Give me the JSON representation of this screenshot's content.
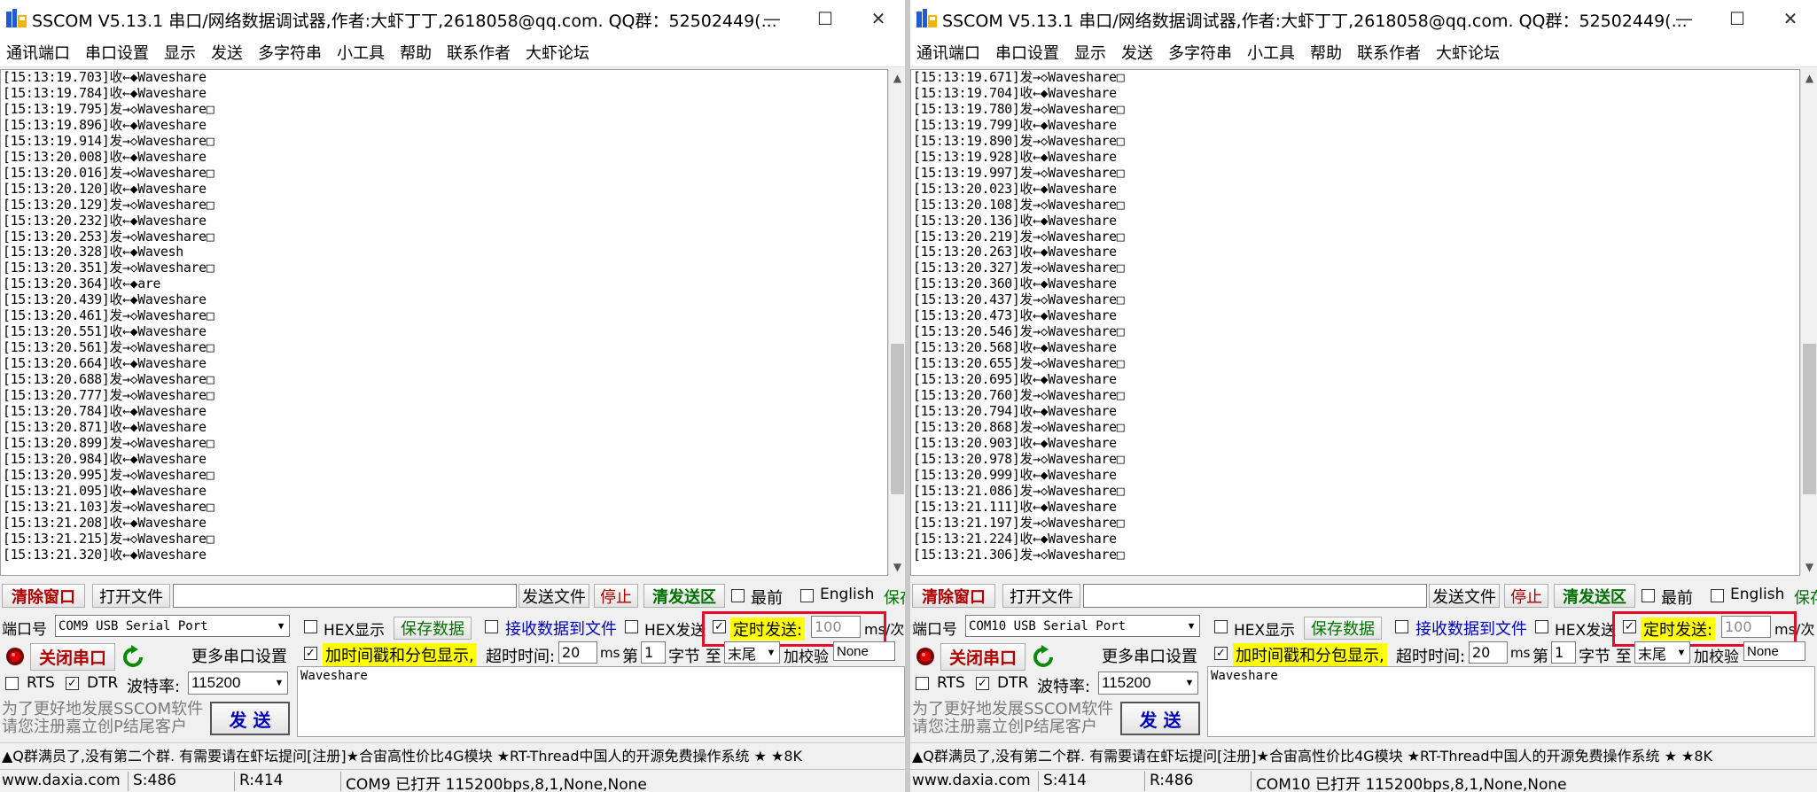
{
  "windows": [
    {
      "title": "SSCOM V5.13.1 串口/网络数据调试器,作者:大虾丁丁,2618058@qq.com. QQ群：52502449(...",
      "menu": [
        "通讯端口",
        "串口设置",
        "显示",
        "发送",
        "多字符串",
        "小工具",
        "帮助",
        "联系作者",
        "大虾论坛"
      ],
      "log": [
        "[15:13:19.703]收←◆Waveshare",
        "[15:13:19.784]收←◆Waveshare",
        "[15:13:19.795]发→◇Waveshare□",
        "[15:13:19.896]收←◆Waveshare",
        "[15:13:19.914]发→◇Waveshare□",
        "[15:13:20.008]收←◆Waveshare",
        "[15:13:20.016]发→◇Waveshare□",
        "[15:13:20.120]收←◆Waveshare",
        "[15:13:20.129]发→◇Waveshare□",
        "[15:13:20.232]收←◆Waveshare",
        "[15:13:20.253]发→◇Waveshare□",
        "[15:13:20.328]收←◆Wavesh",
        "[15:13:20.351]发→◇Waveshare□",
        "[15:13:20.364]收←◆are",
        "[15:13:20.439]收←◆Waveshare",
        "[15:13:20.461]发→◇Waveshare□",
        "[15:13:20.551]收←◆Waveshare",
        "[15:13:20.561]发→◇Waveshare□",
        "[15:13:20.664]收←◆Waveshare",
        "[15:13:20.688]发→◇Waveshare□",
        "[15:13:20.777]发→◇Waveshare□",
        "[15:13:20.784]收←◆Waveshare",
        "[15:13:20.871]收←◆Waveshare",
        "[15:13:20.899]发→◇Waveshare□",
        "[15:13:20.984]收←◆Waveshare",
        "[15:13:20.995]发→◇Waveshare□",
        "[15:13:21.095]收←◆Waveshare",
        "[15:13:21.103]发→◇Waveshare□",
        "[15:13:21.208]收←◆Waveshare",
        "[15:13:21.215]发→◇Waveshare□",
        "[15:13:21.320]收←◆Waveshare"
      ],
      "scroll_position": 0.8,
      "clear_btn": "清除窗口",
      "open_file_btn": "打开文件",
      "send_file_btn": "发送文件",
      "stop_btn": "停止",
      "clear_send_btn": "清发送区",
      "front_label": "最前",
      "english_label": "English",
      "save_param_label": "保存参数",
      "port_label": "端口号",
      "port_value": "COM9 USB Serial Port",
      "hex_display": "HEX显示",
      "save_data_btn": "保存数据",
      "recv_to_file": "接收数据到文件",
      "hex_send": "HEX发送",
      "timed_send": "定时发送:",
      "timed_send_value": "100",
      "timed_unit": "ms/次",
      "close_port_btn": "关闭串口",
      "more_settings_btn": "更多串口设置",
      "timestamp_label": "加时间戳和分包显示,",
      "timeout_label": "超时时间:",
      "timeout_value": "20",
      "ms_label": "ms",
      "byte_prefix": "第",
      "byte_value": "1",
      "byte_mid": "字节 至",
      "byte_end": "末尾",
      "checksum_label": "加校验",
      "checksum_value": "None",
      "rts_label": "RTS",
      "dtr_label": "DTR",
      "baud_label": "波特率:",
      "baud_value": "115200",
      "send_text": "Waveshare",
      "promo_line1": "为了更好地发展SSCOM软件",
      "promo_line2": "请您注册嘉立创P结尾客户",
      "send_btn": "发 送",
      "ticker": "▲Q群满员了,没有第二个群. 有需要请在虾坛提问[注册]★合宙高性价比4G模块 ★RT-Thread中国人的开源免费操作系统 ★ ★8K",
      "status_site": "www.daxia.com",
      "status_s": "S:486",
      "status_r": "R:414",
      "status_port": "COM9 已打开  115200bps,8,1,None,None"
    },
    {
      "title": "SSCOM V5.13.1 串口/网络数据调试器,作者:大虾丁丁,2618058@qq.com. QQ群：52502449(...",
      "menu": [
        "通讯端口",
        "串口设置",
        "显示",
        "发送",
        "多字符串",
        "小工具",
        "帮助",
        "联系作者",
        "大虾论坛"
      ],
      "log": [
        "[15:13:19.671]发→◇Waveshare□",
        "[15:13:19.704]收←◆Waveshare",
        "[15:13:19.780]发→◇Waveshare□",
        "[15:13:19.799]收←◆Waveshare",
        "[15:13:19.890]发→◇Waveshare□",
        "[15:13:19.928]收←◆Waveshare",
        "[15:13:19.997]发→◇Waveshare□",
        "[15:13:20.023]收←◆Waveshare",
        "[15:13:20.108]发→◇Waveshare□",
        "[15:13:20.136]收←◆Waveshare",
        "[15:13:20.219]发→◇Waveshare□",
        "[15:13:20.263]收←◆Waveshare",
        "[15:13:20.327]发→◇Waveshare□",
        "[15:13:20.360]收←◆Waveshare",
        "[15:13:20.437]发→◇Waveshare□",
        "[15:13:20.473]收←◆Waveshare",
        "[15:13:20.546]发→◇Waveshare□",
        "[15:13:20.568]收←◆Waveshare",
        "[15:13:20.655]发→◇Waveshare□",
        "[15:13:20.695]收←◆Waveshare",
        "[15:13:20.760]发→◇Waveshare□",
        "[15:13:20.794]收←◆Waveshare",
        "[15:13:20.868]发→◇Waveshare□",
        "[15:13:20.903]收←◆Waveshare",
        "[15:13:20.978]发→◇Waveshare□",
        "[15:13:20.999]收←◆Waveshare",
        "[15:13:21.086]发→◇Waveshare□",
        "[15:13:21.111]收←◆Waveshare",
        "[15:13:21.197]发→◇Waveshare□",
        "[15:13:21.224]收←◆Waveshare",
        "[15:13:21.306]发→◇Waveshare□"
      ],
      "scroll_position": 0.8,
      "clear_btn": "清除窗口",
      "open_file_btn": "打开文件",
      "send_file_btn": "发送文件",
      "stop_btn": "停止",
      "clear_send_btn": "清发送区",
      "front_label": "最前",
      "english_label": "English",
      "save_param_label": "保存参数",
      "port_label": "端口号",
      "port_value": "COM10 USB Serial Port",
      "hex_display": "HEX显示",
      "save_data_btn": "保存数据",
      "recv_to_file": "接收数据到文件",
      "hex_send": "HEX发送",
      "timed_send": "定时发送:",
      "timed_send_value": "100",
      "timed_unit": "ms/次",
      "close_port_btn": "关闭串口",
      "more_settings_btn": "更多串口设置",
      "timestamp_label": "加时间戳和分包显示,",
      "timeout_label": "超时时间:",
      "timeout_value": "20",
      "ms_label": "ms",
      "byte_prefix": "第",
      "byte_value": "1",
      "byte_mid": "字节 至",
      "byte_end": "末尾",
      "checksum_label": "加校验",
      "checksum_value": "None",
      "rts_label": "RTS",
      "dtr_label": "DTR",
      "baud_label": "波特率:",
      "baud_value": "115200",
      "send_text": "Waveshare",
      "promo_line1": "为了更好地发展SSCOM软件",
      "promo_line2": "请您注册嘉立创P结尾客户",
      "send_btn": "发 送",
      "ticker": "▲Q群满员了,没有第二个群. 有需要请在虾坛提问[注册]★合宙高性价比4G模块 ★RT-Thread中国人的开源免费操作系统 ★ ★8K",
      "status_site": "www.daxia.com",
      "status_s": "S:414",
      "status_r": "R:486",
      "status_port": "COM10 已打开  115200bps,8,1,None,None"
    }
  ],
  "window_controls": {
    "minimize": "—",
    "maximize": "☐",
    "close": "✕"
  },
  "colors": {
    "highlight": "#e0102a",
    "timed_bg": "#ffff00",
    "clear_text": "#b00000",
    "green_btn": "#007000"
  }
}
